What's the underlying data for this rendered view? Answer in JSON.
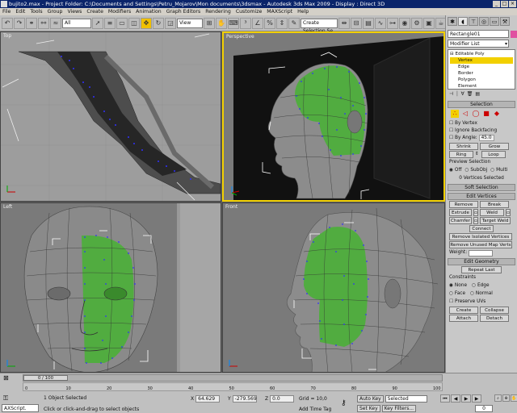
{
  "window": {
    "title": "bujito2.max - Project Folder: C:\\Documents and Settings\\Petru_Mojarov\\Mon documents\\3dsmax - Autodesk 3ds Max 2009 - Display : Direct 3D"
  },
  "menu": [
    "File",
    "Edit",
    "Tools",
    "Group",
    "Views",
    "Create",
    "Modifiers",
    "Animation",
    "Graph Editors",
    "Rendering",
    "Customize",
    "MAXScript",
    "Help"
  ],
  "toolbar": {
    "filter_value": "All",
    "refcoord_value": "View",
    "selection_set_placeholder": "Create Selection Se"
  },
  "viewports": {
    "top": "Top",
    "perspective": "Perspective",
    "left": "Left",
    "front": "Front"
  },
  "command_panel": {
    "object_name": "Rectangle01",
    "object_color": "#e050a0",
    "modifier_list": "Modifier List",
    "stack": {
      "base": "Editable Poly",
      "items": [
        "Vertex",
        "Edge",
        "Border",
        "Polygon",
        "Element"
      ],
      "selected": "Vertex"
    },
    "selection": {
      "header": "Selection",
      "by_vertex": "By Vertex",
      "ignore_backfacing": "Ignore Backfacing",
      "by_angle": "By Angle:",
      "by_angle_value": "45.0",
      "shrink": "Shrink",
      "grow": "Grow",
      "ring": "Ring",
      "loop": "Loop",
      "preview_selection": "Preview Selection",
      "preview_options": [
        "Off",
        "SubObj",
        "Multi"
      ],
      "status": "0 Vertices Selected"
    },
    "soft_selection": {
      "header": "Soft Selection"
    },
    "edit_vertices": {
      "header": "Edit Vertices",
      "remove": "Remove",
      "break": "Break",
      "extrude": "Extrude",
      "weld": "Weld",
      "chamfer": "Chamfer",
      "target_weld": "Target Weld",
      "connect": "Connect",
      "remove_isolated": "Remove Isolated Vertices",
      "remove_unused": "Remove Unused Map Verts",
      "weight": "Weight:"
    },
    "edit_geometry": {
      "header": "Edit Geometry",
      "repeat_last": "Repeat Last",
      "constraints": "Constraints",
      "none": "None",
      "edge": "Edge",
      "face": "Face",
      "normal": "Normal",
      "preserve_uvs": "Preserve UVs",
      "create": "Create",
      "collapse": "Collapse",
      "attach": "Attach",
      "detach": "Detach"
    }
  },
  "timeline": {
    "frame_display": "0 / 100",
    "ticks": [
      "0",
      "10",
      "20",
      "30",
      "40",
      "50",
      "60",
      "70",
      "80",
      "90",
      "100"
    ],
    "current_frame": "0"
  },
  "status": {
    "objects_selected": "1 Object Selected",
    "prompt": "Click or click-and-drag to select objects",
    "x_value": "64.629",
    "y_value": "-279.569",
    "z_value": "0.0",
    "grid": "Grid = 10,0",
    "add_time_tag": "Add Time Tag",
    "auto_key": "Auto Key",
    "auto_key_dropdown": "Selected",
    "set_key": "Set Key",
    "key_filters": "Key Filters...",
    "maxscript": "AXScript."
  },
  "colors": {
    "selected_mesh": "#4caf3a",
    "active_viewport_border": "#f2d000",
    "vertex": "#3030ff"
  }
}
